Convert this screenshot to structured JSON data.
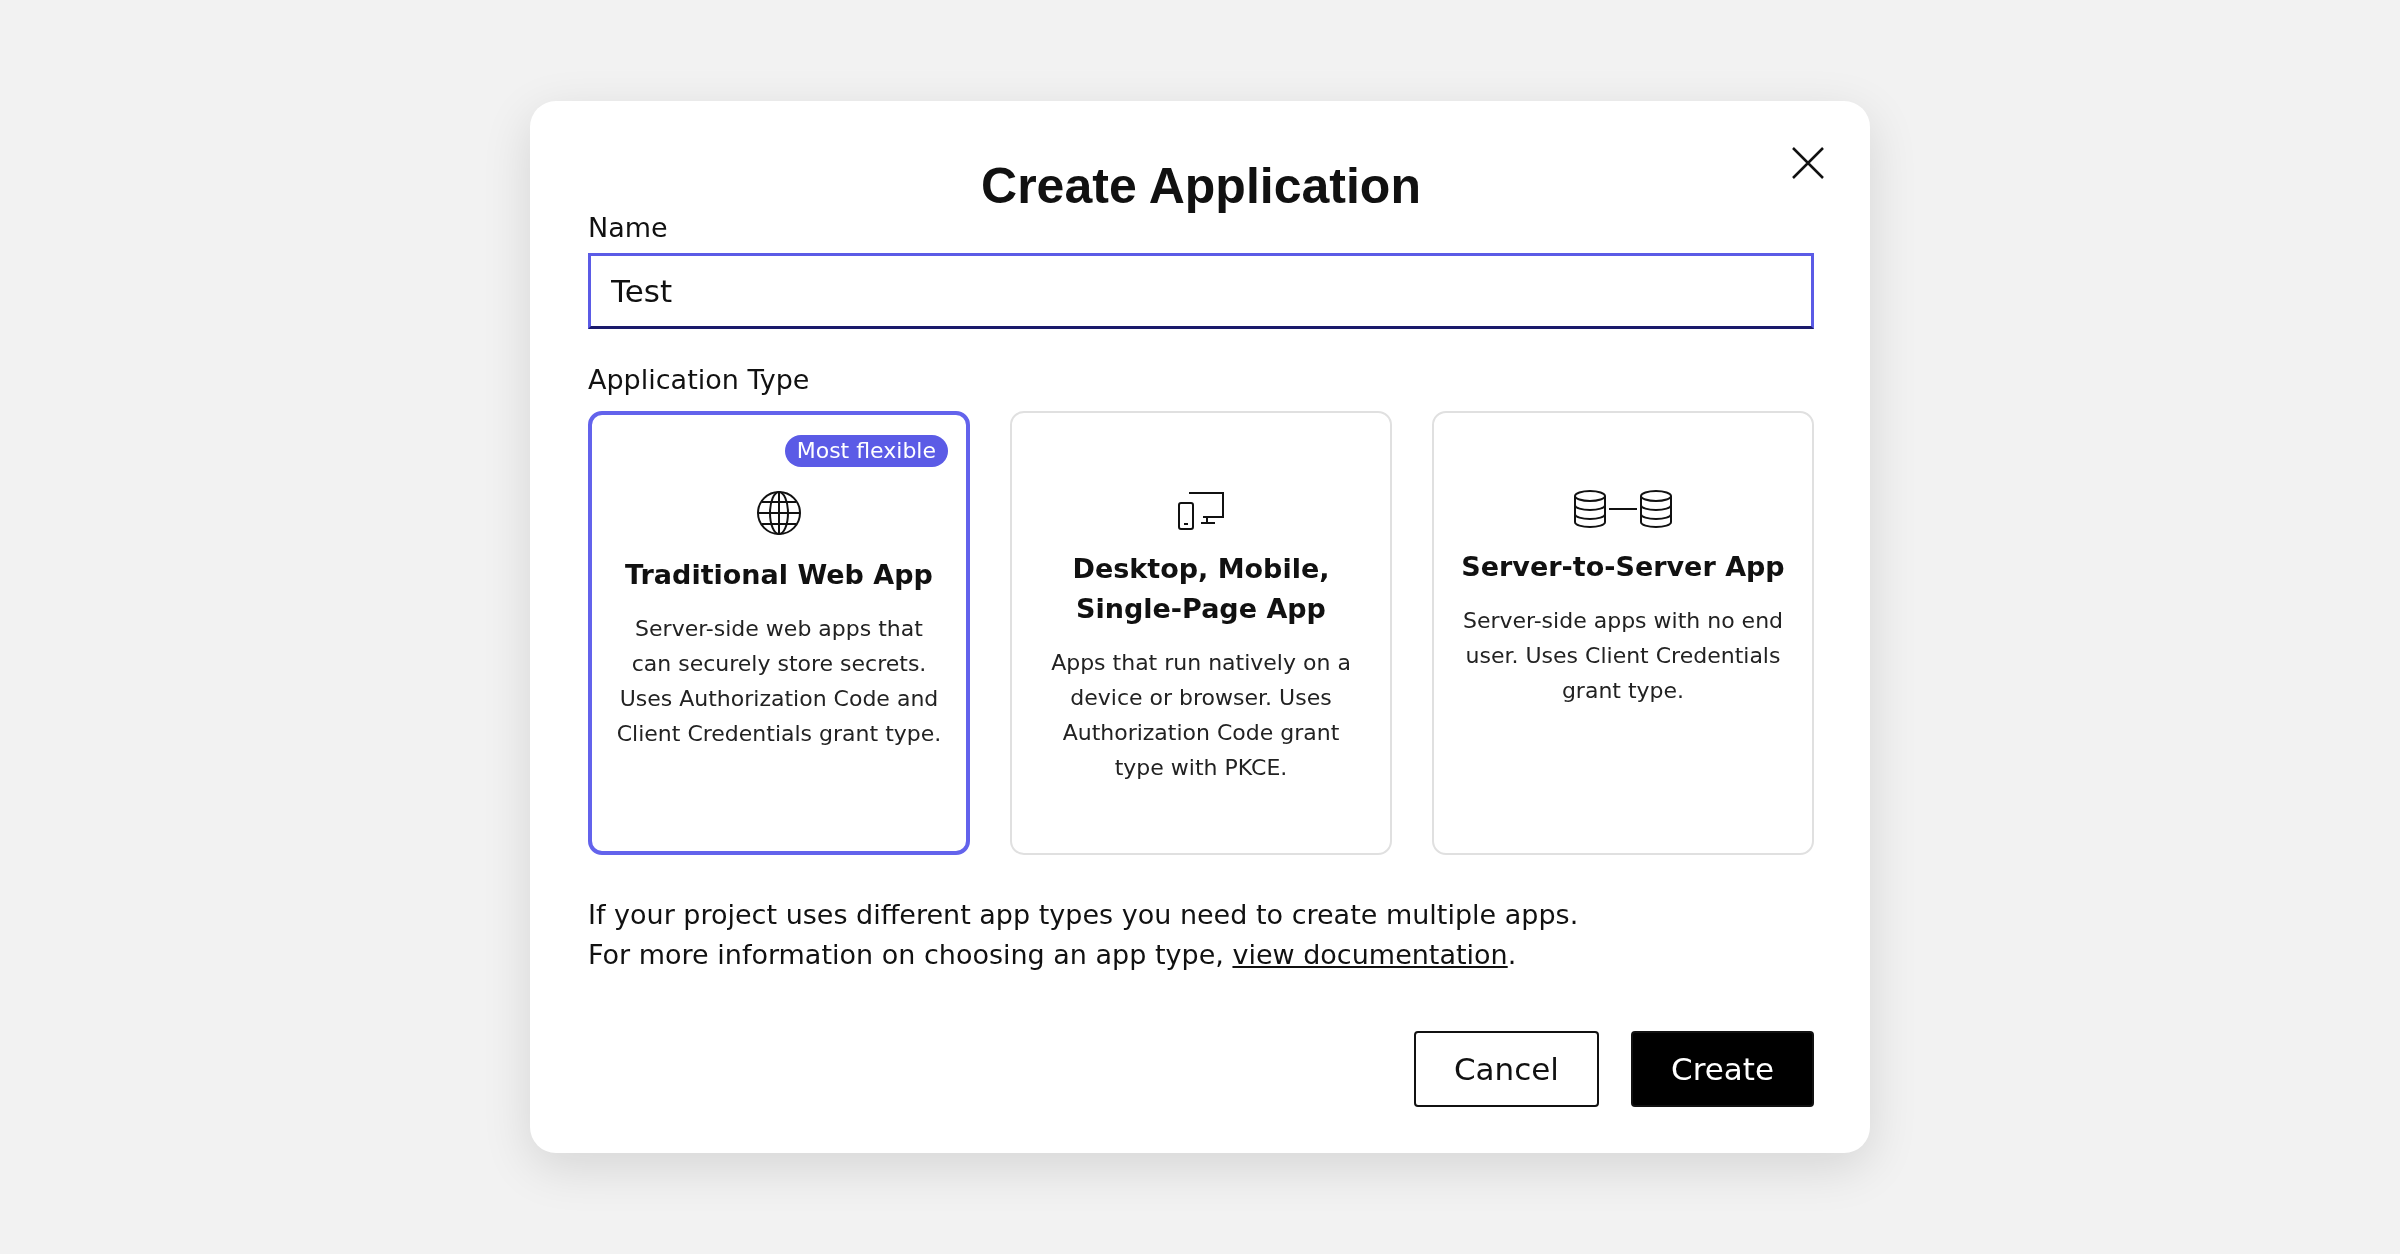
{
  "dialog": {
    "title": "Create Application",
    "name_field": {
      "label": "Name",
      "value": "Test",
      "focused": true
    },
    "type_label": "Application Type",
    "app_types": [
      {
        "kind": "web",
        "title": "Traditional Web App",
        "badge": "Most flexible",
        "description": "Server-side web apps that can securely store secrets. Uses Authorization Code and Client Credentials grant type.",
        "selected": true
      },
      {
        "kind": "device",
        "title": "Desktop, Mobile, Single-Page App",
        "description": "Apps that run natively on a device or browser. Uses Authorization Code grant type with PKCE.",
        "selected": false
      },
      {
        "kind": "server",
        "title": "Server-to-Server App",
        "description": "Server-side apps with no end user. Uses Client Credentials grant type.",
        "selected": false
      }
    ],
    "info_line_1": "If your project uses different app types you need to create multiple apps.",
    "info_line_2": {
      "text": "For more information on choosing an app type,",
      "link": "view documentation",
      "after": "."
    },
    "buttons": [
      {
        "label": "Cancel",
        "kind": "secondary"
      },
      {
        "label": "Create",
        "kind": "primary"
      }
    ]
  }
}
